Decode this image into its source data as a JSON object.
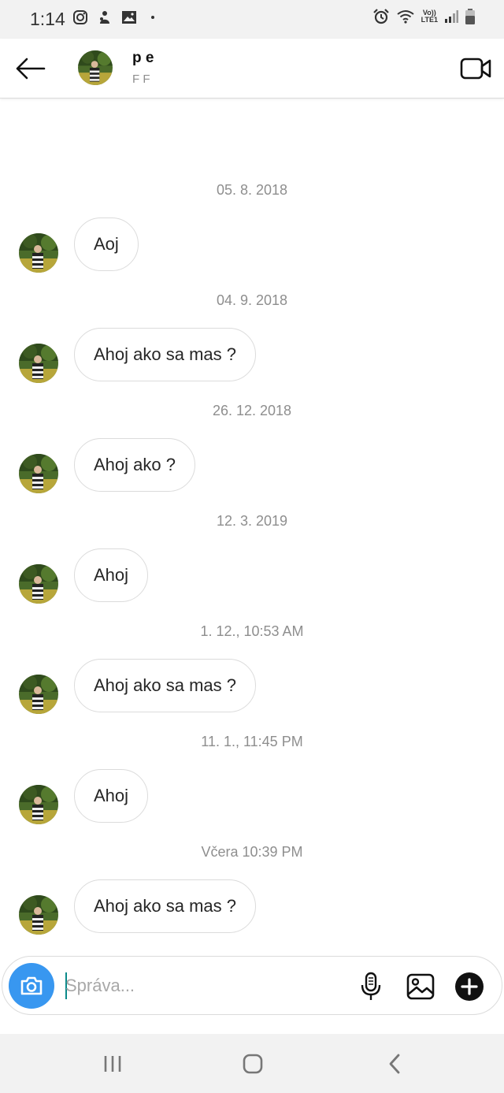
{
  "status_bar": {
    "time": "1:14",
    "icons_left": [
      "instagram-icon",
      "notification-app-icon",
      "image-icon",
      "dot-icon"
    ],
    "icons_right": [
      "alarm-icon",
      "wifi-icon",
      "volte-lte-icon",
      "signal-icon",
      "battery-icon"
    ],
    "volte_text": "Vo))",
    "lte_text": "LTE1"
  },
  "header": {
    "name": "p      e",
    "subtitle": "F      F"
  },
  "messages": [
    {
      "timestamp": "05. 8. 2018",
      "text": "Aoj"
    },
    {
      "timestamp": "04. 9. 2018",
      "text": "Ahoj ako sa mas ?"
    },
    {
      "timestamp": "26. 12. 2018",
      "text": "Ahoj ako ?"
    },
    {
      "timestamp": "12. 3. 2019",
      "text": "Ahoj"
    },
    {
      "timestamp": "1. 12., 10:53 AM",
      "text": "Ahoj ako sa mas ?"
    },
    {
      "timestamp": "11. 1., 11:45 PM",
      "text": "Ahoj"
    },
    {
      "timestamp": "Včera 10:39 PM",
      "text": "Ahoj ako sa mas ?"
    }
  ],
  "composer": {
    "placeholder": "Správa...",
    "value": ""
  },
  "colors": {
    "accent": "#3897f0",
    "bubble_border": "#dbdbdb",
    "timestamp_text": "#8e8e8e",
    "caret": "#0a8a8a"
  }
}
